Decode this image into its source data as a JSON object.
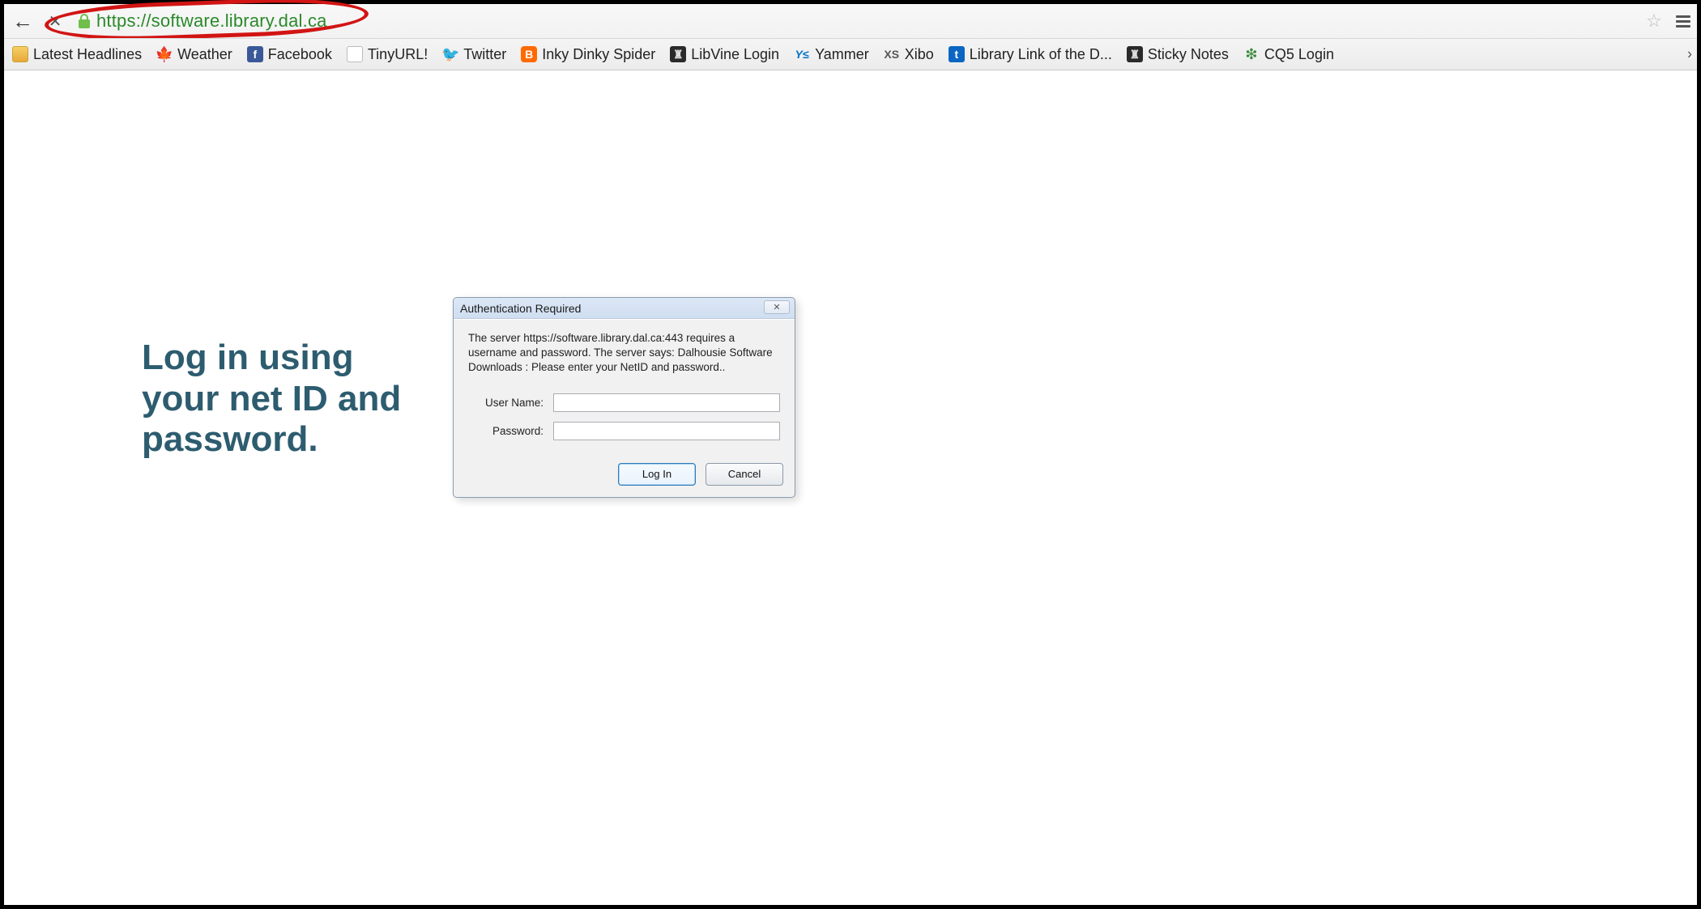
{
  "address_bar": {
    "url": "https://software.library.dal.ca"
  },
  "bookmarks": [
    {
      "icon": "folder",
      "label": "Latest Headlines"
    },
    {
      "icon": "weather",
      "label": "Weather"
    },
    {
      "icon": "fb",
      "label": "Facebook"
    },
    {
      "icon": "doc",
      "label": "TinyURL!"
    },
    {
      "icon": "tw",
      "label": "Twitter"
    },
    {
      "icon": "blogger",
      "label": "Inky Dinky Spider"
    },
    {
      "icon": "libvine",
      "label": "LibVine Login"
    },
    {
      "icon": "yammer",
      "label": "Yammer"
    },
    {
      "icon": "xibo",
      "label": "Xibo"
    },
    {
      "icon": "liblink",
      "label": "Library Link of the D..."
    },
    {
      "icon": "sticky",
      "label": "Sticky Notes"
    },
    {
      "icon": "cq5",
      "label": "CQ5 Login"
    }
  ],
  "instruction": "Log in using your net ID and password.",
  "dialog": {
    "title": "Authentication Required",
    "message": "The server https://software.library.dal.ca:443 requires a username and password. The server says: Dalhousie Software Downloads : Please enter your NetID and password..",
    "username_label": "User Name:",
    "password_label": "Password:",
    "username_value": "",
    "password_value": "",
    "login_label": "Log In",
    "cancel_label": "Cancel",
    "close_glyph": "✕"
  }
}
